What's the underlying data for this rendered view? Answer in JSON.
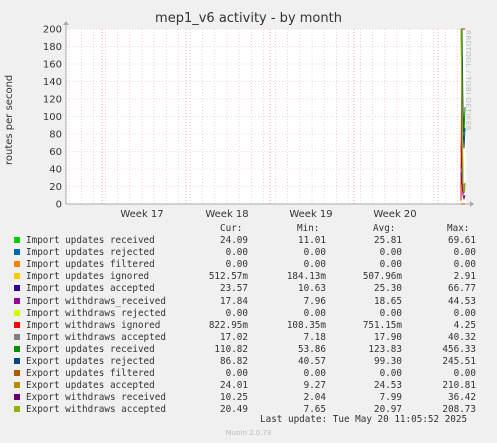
{
  "title": "mep1_v6 activity - by month",
  "side_text": "RRDTOOL / TOBI OETIKER",
  "footer": "Munin 2.0.73",
  "last_update": "Last update: Tue May 20 11:05:52 2025",
  "headers": [
    "Cur:",
    "Min:",
    "Avg:",
    "Max:"
  ],
  "chart_data": {
    "type": "line",
    "ylabel": "routes per second",
    "ylim": [
      0,
      200
    ],
    "y_ticks": [
      0,
      20,
      40,
      60,
      80,
      100,
      120,
      140,
      160,
      180,
      200
    ],
    "x_ticks": [
      "Week 17",
      "Week 18",
      "Week 19",
      "Week 20"
    ],
    "grid": true,
    "series": [
      {
        "name": "Import updates received",
        "color": "#00cc00",
        "cur": "24.09",
        "min": "11.01",
        "avg": "25.81",
        "max": "69.61"
      },
      {
        "name": "Import updates rejected",
        "color": "#0066b3",
        "cur": "0.00",
        "min": "0.00",
        "avg": "0.00",
        "max": "0.00"
      },
      {
        "name": "Import updates filtered",
        "color": "#ff8000",
        "cur": "0.00",
        "min": "0.00",
        "avg": "0.00",
        "max": "0.00"
      },
      {
        "name": "Import updates ignored",
        "color": "#ffcc00",
        "cur": "512.57m",
        "min": "184.13m",
        "avg": "507.96m",
        "max": "2.91"
      },
      {
        "name": "Import updates accepted",
        "color": "#330099",
        "cur": "23.57",
        "min": "10.63",
        "avg": "25.30",
        "max": "66.77"
      },
      {
        "name": "Import withdraws_received",
        "color": "#990099",
        "cur": "17.84",
        "min": "7.96",
        "avg": "18.65",
        "max": "44.53"
      },
      {
        "name": "Import withdraws rejected",
        "color": "#ccff00",
        "cur": "0.00",
        "min": "0.00",
        "avg": "0.00",
        "max": "0.00"
      },
      {
        "name": "Import withdraws ignored",
        "color": "#ff0000",
        "cur": "822.95m",
        "min": "108.35m",
        "avg": "751.15m",
        "max": "4.25"
      },
      {
        "name": "Import withdraws accepted",
        "color": "#808080",
        "cur": "17.02",
        "min": "7.18",
        "avg": "17.90",
        "max": "40.32"
      },
      {
        "name": "Export updates received",
        "color": "#008f00",
        "cur": "110.82",
        "min": "53.86",
        "avg": "123.83",
        "max": "456.33"
      },
      {
        "name": "Export updates rejected",
        "color": "#00487d",
        "cur": "86.82",
        "min": "40.57",
        "avg": "99.30",
        "max": "245.51"
      },
      {
        "name": "Export updates filtered",
        "color": "#b35a00",
        "cur": "0.00",
        "min": "0.00",
        "avg": "0.00",
        "max": "0.00"
      },
      {
        "name": "Export updates accepted",
        "color": "#b38f00",
        "cur": "24.01",
        "min": "9.27",
        "avg": "24.53",
        "max": "210.81"
      },
      {
        "name": "Export withdraws received",
        "color": "#6b006b",
        "cur": "10.25",
        "min": "2.04",
        "avg": "7.99",
        "max": "36.42"
      },
      {
        "name": "Export withdraws accepted",
        "color": "#8fb300",
        "cur": "20.49",
        "min": "7.65",
        "avg": "20.97",
        "max": "208.73"
      }
    ]
  }
}
